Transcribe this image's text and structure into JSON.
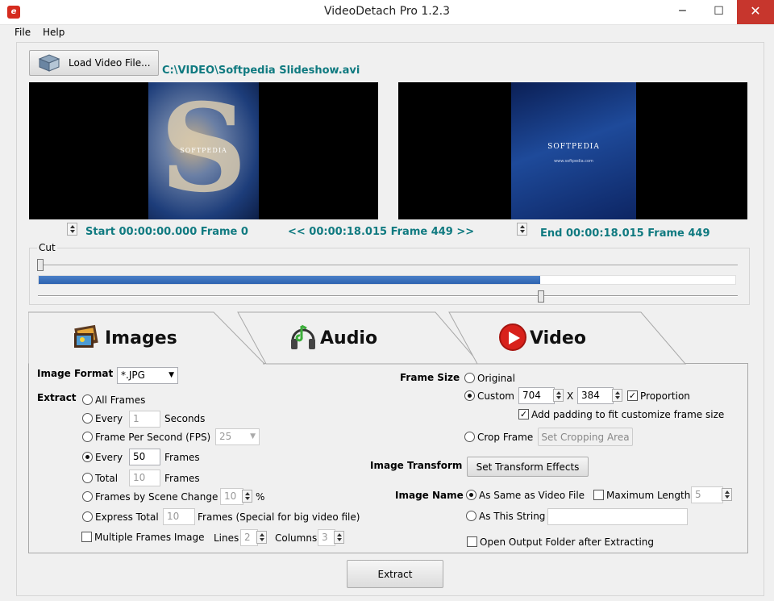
{
  "window": {
    "title": "VideoDetach Pro 1.2.3",
    "minimize": "─",
    "maximize": "☐",
    "close": "✕"
  },
  "menu": {
    "file": "File",
    "help": "Help"
  },
  "loader": {
    "button": "Load Video File...",
    "path": "C:\\VIDEO\\Softpedia Slideshow.avi"
  },
  "preview_left": {
    "logo_letter": "S",
    "brand": "SOFTPEDIA"
  },
  "preview_right": {
    "brand": "SOFTPEDIA",
    "url": "www.softpedia.com"
  },
  "timing": {
    "start": "Start 00:00:00.000  Frame 0",
    "middle": "<< 00:00:18.015   Frame 449 >>",
    "end": "End 00:00:18.015   Frame 449"
  },
  "cut": {
    "label": "Cut",
    "progress_percent": 72,
    "start_thumb_fraction": 0.0,
    "end_thumb_fraction": 0.72
  },
  "tabs": {
    "images": "Images",
    "audio": "Audio",
    "video": "Video"
  },
  "image_format": {
    "label": "Image Format",
    "value": "*.JPG"
  },
  "extract": {
    "label": "Extract",
    "all_frames": "All Frames",
    "every_seconds_label": "Every",
    "every_seconds_value": "1",
    "seconds": "Seconds",
    "fps_label": "Frame Per Second (FPS)",
    "fps_value": "25",
    "every_frames_label": "Every",
    "every_frames_value": "50",
    "frames": "Frames",
    "total_label": "Total",
    "total_value": "10",
    "total_frames": "Frames",
    "scene_label": "Frames by Scene Change",
    "scene_value": "10",
    "percent": "%",
    "express_label": "Express Total",
    "express_value": "10",
    "express_suffix": "Frames (Special for big video file)",
    "multi_label": "Multiple Frames Image",
    "lines_label": "Lines",
    "lines_value": "2",
    "columns_label": "Columns",
    "columns_value": "3"
  },
  "frame_size": {
    "label": "Frame Size",
    "original": "Original",
    "custom": "Custom",
    "width": "704",
    "x": "X",
    "height": "384",
    "proportion": "Proportion",
    "padding": "Add padding to fit customize frame size",
    "crop": "Crop Frame",
    "crop_button": "Set Cropping Area"
  },
  "transform": {
    "label": "Image Transform",
    "button": "Set Transform Effects"
  },
  "image_name": {
    "label": "Image Name",
    "same": "As Same as Video File",
    "max_len": "Maximum Length",
    "max_value": "5",
    "string": "As This String",
    "string_value": ""
  },
  "open_folder": "Open Output Folder after Extracting",
  "extract_button": "Extract"
}
